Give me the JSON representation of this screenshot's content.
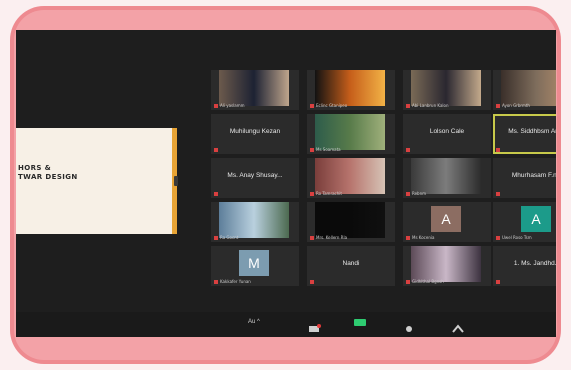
{
  "slide": {
    "lines": [
      "HORS &",
      "TWAR DESIGN"
    ]
  },
  "participants": [
    {
      "label": "Ali yaslamm",
      "video_colors": [
        "#6c5a4c",
        "#1d2233",
        "#bfa58c"
      ]
    },
    {
      "label": "Eclinc Gtanipeo",
      "video_colors": [
        "#121212",
        "#c65e1a",
        "#f2b246"
      ]
    },
    {
      "label": "Abi Lanbrun Kalon",
      "video_colors": [
        "#7a6a56",
        "#2a2730",
        "#c3a98b"
      ]
    },
    {
      "label": "Ayon Grbrmth",
      "video_colors": [
        "#3a2f2a",
        "#7e6d5c",
        "#b88f6c"
      ]
    },
    {
      "name": "Muhilungu Kezan",
      "label": ""
    },
    {
      "label": "Ms Soamata",
      "video_colors": [
        "#2d5c4b",
        "#587b4a",
        "#9fb07b"
      ]
    },
    {
      "name": "Lolson Cale",
      "label": ""
    },
    {
      "name": "Ms. Siddhbsm Anxa",
      "label": "",
      "active": true
    },
    {
      "name": "Ms. Anay Shusay...",
      "label": ""
    },
    {
      "label": "Ro Tamrachit",
      "video_colors": [
        "#7a3e3b",
        "#b7746d",
        "#d6c3b5"
      ]
    },
    {
      "label": "Rebnm",
      "video_colors": [
        "#3a3a3a",
        "#7c7c7c",
        "#2c2c2c"
      ]
    },
    {
      "name": "Mhurhasam F.nm",
      "label": ""
    },
    {
      "label": "Ra Gocnt",
      "video_colors": [
        "#5d7e9a",
        "#b9d0de",
        "#4c6a50"
      ]
    },
    {
      "label": "Mrs. Kellern Rla",
      "video_colors": [
        "#0a0a0a",
        "#0a0a0a",
        "#101010"
      ]
    },
    {
      "label": "Ms Kocenia",
      "avatar": "A",
      "avatar_bg": "#8c6d62"
    },
    {
      "label": "Uwel Roso Tsm",
      "avatar": "A",
      "avatar_bg": "#1c9b8a"
    },
    {
      "label": "Kakkafer Yunan",
      "avatar": "M",
      "avatar_bg": "#7c9cb0"
    },
    {
      "name": "Nandi",
      "label": ""
    },
    {
      "label": "Gidhlthal Bgnsh",
      "video_colors": [
        "#5c4a57",
        "#c9b7c7",
        "#3d3340"
      ]
    },
    {
      "name": "1. Ms. Jandhd...",
      "label": ""
    }
  ],
  "toolbar": {
    "audio_label": "Au ^",
    "chat_badge": "1",
    "items": [
      "participants-icon",
      "camera-icon",
      "reactions-icon",
      "more-icon"
    ]
  },
  "colors": {
    "frame": "#ee8a90",
    "screen": "#1e1e1e",
    "active_outline": "#c7c94a"
  }
}
